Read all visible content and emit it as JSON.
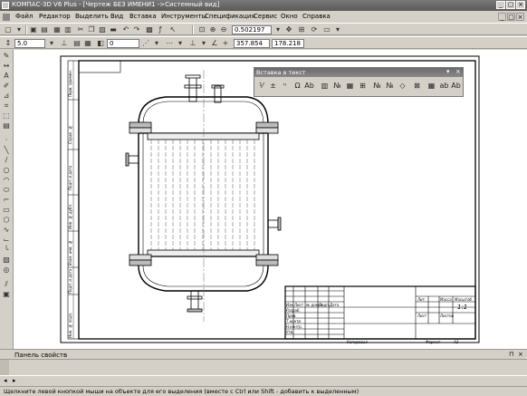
{
  "title": {
    "text": "КОМПАС-3D V6 Plus - [Чертеж БЕЗ ИМЕНИ1 ->Системный вид]",
    "controls": [
      "_",
      "▢",
      "×"
    ]
  },
  "menu": {
    "items": [
      "Файл",
      "Редактор",
      "Выделить",
      "Вид",
      "Вставка",
      "Инструменты",
      "Спецификация",
      "Сервис",
      "Окно",
      "Справка"
    ],
    "mdi_controls": [
      "_",
      "▢",
      "×"
    ]
  },
  "toolbar2": {
    "scale": "0.502197",
    "icons": [
      "new-icon",
      "open-icon",
      "save-icon",
      "print-icon",
      "preview-icon",
      "cut-icon",
      "copy-icon",
      "paste-icon",
      "undo-icon",
      "redo-icon",
      "fx-icon",
      "help-pointer-icon",
      "zoom-in-icon",
      "zoom-out-icon",
      "zoom-window-icon",
      "pan-icon",
      "refresh-icon",
      "fit-icon"
    ]
  },
  "toolbar3": {
    "step": "5.0",
    "layer": "0",
    "coord_x": "357.854",
    "coord_y": "178.218"
  },
  "float_panel": {
    "title": "Вставка в текст",
    "controls": [
      "▾",
      "×"
    ]
  },
  "title_block": {
    "fields": [
      "Изм",
      "Лист",
      "№ докум.",
      "Подп.",
      "Дата",
      "Разраб.",
      "Пров.",
      "Т.контр.",
      "Н.контр.",
      "Утв.",
      "Лит.",
      "Масса",
      "Масштаб",
      "Лист",
      "Листов",
      "1:1",
      "Копировал",
      "Формат",
      "A3"
    ],
    "sheet_scale": "1:1",
    "copied": "Копировал",
    "format_label": "Формат",
    "format_value": "A3"
  },
  "side_stamp": {
    "fields": [
      "Перв. примен.",
      "Справ. №",
      "Подп. и дата",
      "Инв. № дубл.",
      "Взам. инв. №",
      "Подп. и дата",
      "Инв. № подл."
    ]
  },
  "panel": {
    "label": "Панель свойств"
  },
  "status": {
    "text": "Щелкните левой кнопкой мыши на объекте для его выделения (вместе с Ctrl или Shift - добавить к выделенным)"
  }
}
